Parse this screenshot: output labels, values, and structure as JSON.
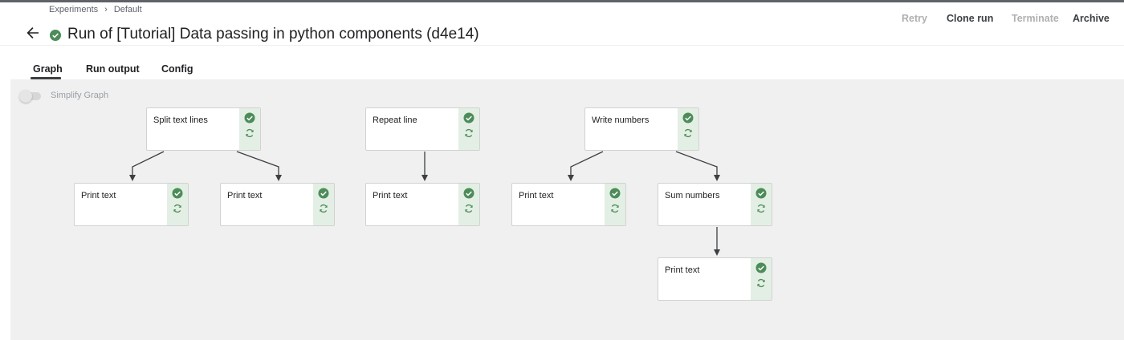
{
  "breadcrumb": {
    "experiments": "Experiments",
    "separator": "›",
    "current": "Default"
  },
  "header": {
    "title": "Run of [Tutorial] Data passing in python components (d4e14)",
    "status": "succeeded"
  },
  "actions": {
    "retry": "Retry",
    "clone_run": "Clone run",
    "terminate": "Terminate",
    "archive": "Archive"
  },
  "tabs": {
    "graph": "Graph",
    "run_output": "Run output",
    "config": "Config"
  },
  "graph": {
    "simplify_label": "Simplify Graph",
    "nodes": [
      {
        "label": "Split text lines"
      },
      {
        "label": "Repeat line"
      },
      {
        "label": "Write numbers"
      },
      {
        "label": "Print text"
      },
      {
        "label": "Print text"
      },
      {
        "label": "Print text"
      },
      {
        "label": "Print text"
      },
      {
        "label": "Sum numbers"
      },
      {
        "label": "Print text"
      }
    ]
  },
  "colors": {
    "success": "#4c8c59",
    "node_side": "#e3efe4",
    "canvas": "#f0f0f0",
    "edge": "#3c4043"
  }
}
